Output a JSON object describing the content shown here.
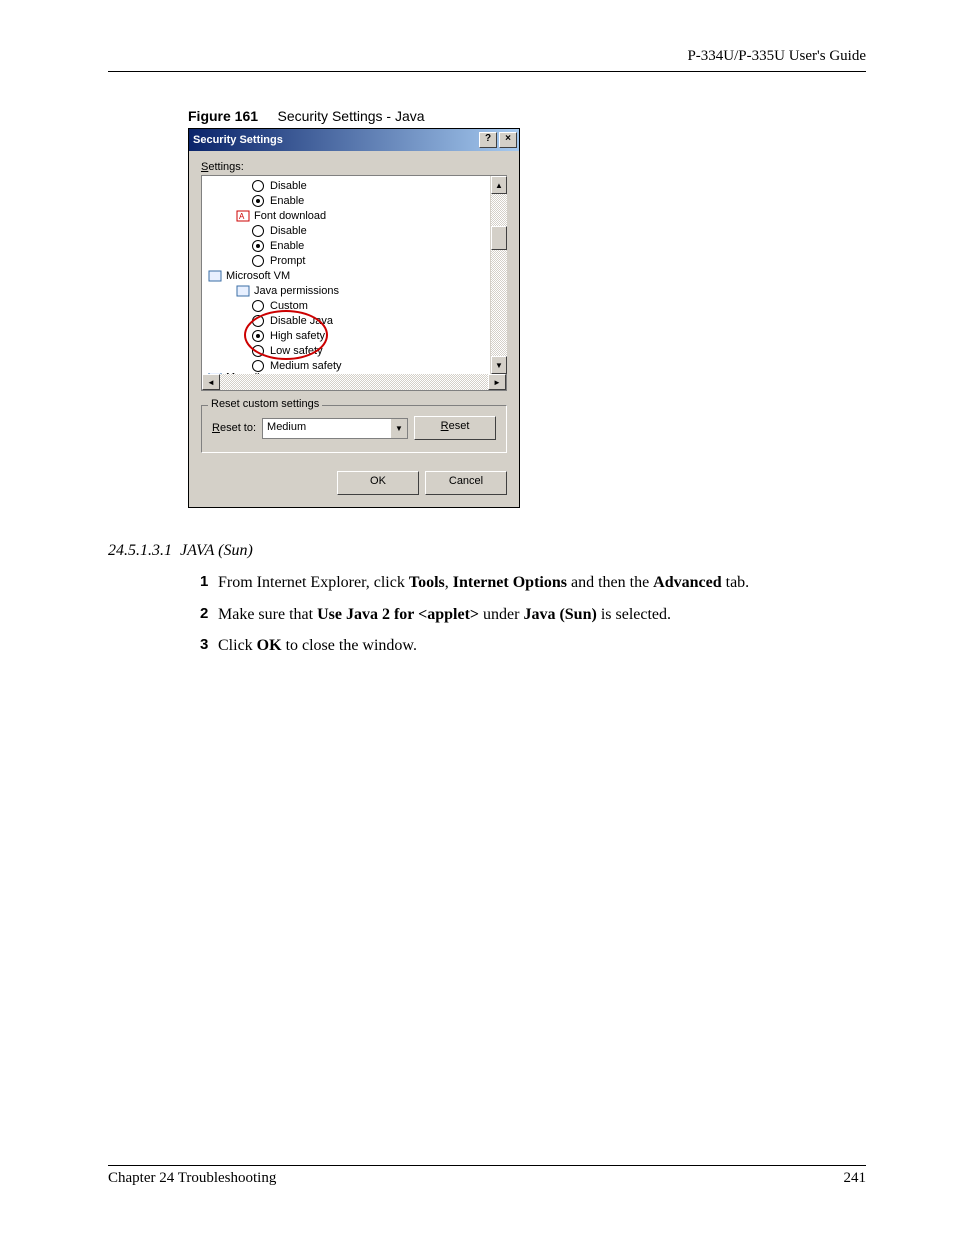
{
  "header": {
    "guide": "P-334U/P-335U User's Guide"
  },
  "figure": {
    "number": "Figure 161",
    "caption": "Security Settings - Java"
  },
  "dialog": {
    "title": "Security Settings",
    "help_btn": "?",
    "close_btn": "×",
    "settings_label_pre": "S",
    "settings_label_rest": "ettings:",
    "tree": {
      "r1": {
        "label": "Disable",
        "selected": false
      },
      "r2": {
        "label": "Enable",
        "selected": true
      },
      "g_font": "Font download",
      "r3": {
        "label": "Disable",
        "selected": false
      },
      "r4": {
        "label": "Enable",
        "selected": true
      },
      "r5": {
        "label": "Prompt",
        "selected": false
      },
      "g_msvm": "Microsoft VM",
      "g_javaperm": "Java permissions",
      "r6": {
        "label": "Custom",
        "selected": false
      },
      "r7": {
        "label": "Disable Java",
        "selected": false
      },
      "r8": {
        "label": "High safety",
        "selected": true
      },
      "r9": {
        "label": "Low safety",
        "selected": false
      },
      "r10": {
        "label": "Medium safety",
        "selected": false
      },
      "g_misc_partial": "Miscellaneous"
    },
    "fieldset": {
      "legend": "Reset custom settings",
      "reset_to_pre": "R",
      "reset_to_rest": "eset to:",
      "combo_value": "Medium",
      "reset_btn_pre": "R",
      "reset_btn_rest": "eset"
    },
    "ok": "OK",
    "cancel": "Cancel"
  },
  "section": {
    "number": "24.5.1.3.1",
    "title": "JAVA (Sun)"
  },
  "steps": {
    "s1": {
      "n": "1",
      "t1": "From Internet Explorer, click ",
      "b1": "Tools",
      "t2": ", ",
      "b2": "Internet Options",
      "t3": " and then the ",
      "b3": "Advanced",
      "t4": " tab."
    },
    "s2": {
      "n": "2",
      "t1": "Make sure that ",
      "b1": "Use Java 2 for <applet>",
      "t2": " under ",
      "b2": "Java (Sun)",
      "t3": " is selected."
    },
    "s3": {
      "n": "3",
      "t1": "Click ",
      "b1": "OK",
      "t2": " to close the window."
    }
  },
  "footer": {
    "chapter": "Chapter 24 Troubleshooting",
    "page": "241"
  }
}
